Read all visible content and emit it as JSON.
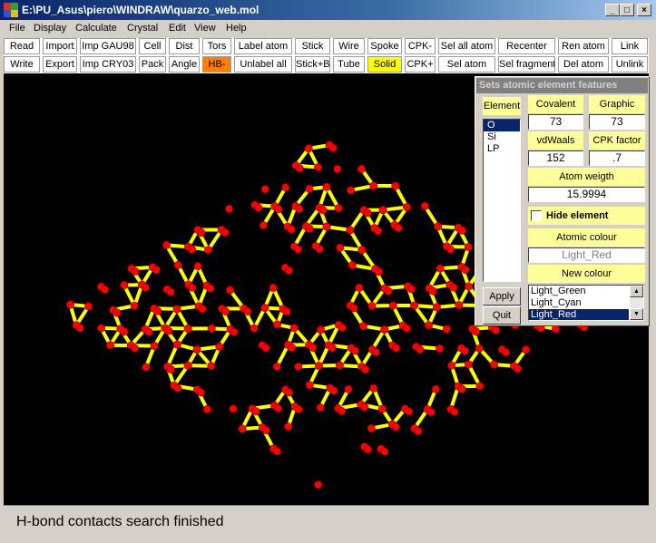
{
  "window": {
    "title": "E:\\PU_Asus\\piero\\WINDRAW\\quarzo_web.mol",
    "min": "_",
    "max": "□",
    "close": "×"
  },
  "menu": [
    "File",
    "Display",
    "Calculate",
    "Crystal",
    "Edit",
    "View",
    "Help"
  ],
  "toolbar": {
    "row1": [
      "Read",
      "Import",
      "Imp GAU98",
      "Cell",
      "Dist",
      "Tors",
      "Label atom",
      "Stick",
      "Wire",
      "Spoke",
      "CPK-",
      "Sel all atom",
      "Recenter",
      "Ren atom",
      "Link"
    ],
    "row2": [
      "Write",
      "Export",
      "Imp CRY03",
      "Pack",
      "Angle",
      "HB-",
      "Unlabel all",
      "Stick+B",
      "Tube",
      "Solid",
      "CPK+",
      "Sel atom",
      "Sel fragment",
      "Del atom",
      "Unlink"
    ],
    "highlight_colors": {
      "orange": "#ff8000",
      "yellow": "#ffff00"
    }
  },
  "molecule": {
    "atom_color": "#ff0000",
    "bond_color": "#ffff00",
    "background": "#000000"
  },
  "panel": {
    "title": "Sets atomic element features",
    "element_header": "Element",
    "elements": [
      "O",
      "Si",
      "LP"
    ],
    "selected_element": "O",
    "covalent_label": "Covalent",
    "covalent_value": "73",
    "graphic_label": "Graphic",
    "graphic_value": "73",
    "vdwaals_label": "vdWaals",
    "vdwaals_value": "152",
    "cpk_label": "CPK factor",
    "cpk_value": ".7",
    "weight_label": "Atom weigth",
    "weight_value": "15.9994",
    "hide_label": "Hide element",
    "colour_label": "Atomic colour",
    "colour_value": "Light_Red",
    "new_colour_label": "New  colour",
    "colour_options": [
      "Light_Green",
      "Light_Cyan",
      "Light_Red"
    ],
    "selected_colour": "Light_Red",
    "apply_label": "Apply",
    "quit_label": "Quit",
    "scroll_up_icon": "▲",
    "scroll_down_icon": "▼"
  },
  "status": {
    "text": "H-bond contacts search finished"
  }
}
